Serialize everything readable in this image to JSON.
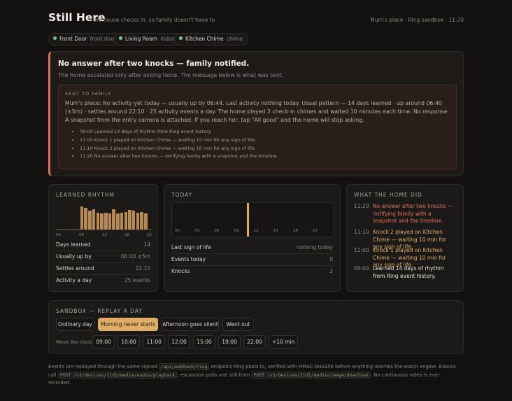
{
  "header": {
    "title": "Still Here",
    "tagline": "the house checks in, so family doesn't have to",
    "status": "Mum's place · Ring sandbox · 11:20"
  },
  "devices": [
    {
      "name": "Front Door",
      "type": "front door"
    },
    {
      "name": "Living Room",
      "type": "indoor"
    },
    {
      "name": "Kitchen Chime",
      "type": "chime"
    }
  ],
  "alert": {
    "title": "No answer after two knocks — family notified.",
    "subtitle": "The home escalated only after asking twice. The message below is what was sent.",
    "sent_label": "SENT TO FAMILY",
    "message": "Mum's place: No activity yet today — usually up by 06:44. Last activity nothing today. Usual pattern — 14 days learned · up around 06:40 (±5m) · settles around 22:10 · 25 activity events a day. The home played 2 check-in chimes and waited 10 minutes each time. No response. A snapshot from the entry camera is attached. If you reach her, tap \"All good\" and the home will stop asking.",
    "log": [
      "09:00 Learned 14 days of rhythm from Ring event history.",
      "11:00 Knock 1 played on Kitchen Chime — waiting 10 min for any sign of life.",
      "11:10 Knock 2 played on Kitchen Chime — waiting 10 min for any sign of life.",
      "11:20 No answer after two knocks — notifying family with a snapshot and the timeline."
    ]
  },
  "rhythm": {
    "title": "LEARNED RHYTHM",
    "axis": [
      "00",
      "06",
      "12",
      "18",
      "23"
    ],
    "hourly_activity": [
      0,
      0,
      0,
      0,
      0,
      0,
      0.82,
      0.78,
      0.68,
      0.72,
      0.6,
      0.58,
      0.6,
      0.58,
      0.72,
      0.58,
      0.6,
      0.62,
      0.7,
      0.68,
      0.6,
      0.62,
      0.58,
      0
    ],
    "rows": [
      {
        "k": "Days learned",
        "v": "14"
      },
      {
        "k": "Usually up by",
        "v": "06:40 ±5m"
      },
      {
        "k": "Settles around",
        "v": "22:10"
      },
      {
        "k": "Activity a day",
        "v": "25 events"
      }
    ]
  },
  "today": {
    "title": "TODAY",
    "axis": [
      "00",
      "03",
      "06",
      "09",
      "12",
      "15",
      "18",
      "21"
    ],
    "now_hour": 11.33,
    "rows": [
      {
        "k": "Last sign of life",
        "v": "nothing today"
      },
      {
        "k": "Events today",
        "v": "0"
      },
      {
        "k": "Knocks",
        "v": "2"
      }
    ]
  },
  "timeline": {
    "title": "WHAT THE HOME DID",
    "entries": [
      {
        "time": "11:20",
        "text": "No answer after two knocks — notifying family with a snapshot and the timeline.",
        "tone": "alert"
      },
      {
        "time": "11:10",
        "text": "Knock 2 played on Kitchen Chime — waiting 10 min for any sign of life.",
        "tone": "warn"
      },
      {
        "time": "11:00",
        "text": "Knock 1 played on Kitchen Chime — waiting 10 min for any sign of life.",
        "tone": "warn"
      },
      {
        "time": "09:00",
        "text": "Learned 14 days of rhythm from Ring event history.",
        "tone": "normal"
      }
    ]
  },
  "sandbox": {
    "title": "SANDBOX — REPLAY A DAY",
    "scenarios": [
      "Ordinary day",
      "Morning never starts",
      "Afternoon goes silent",
      "Went out"
    ],
    "active_scenario": "Morning never starts",
    "clock_label": "Move the clock:",
    "clock_buttons": [
      "09:00",
      "10:00",
      "11:00",
      "12:00",
      "15:00",
      "19:00",
      "22:00",
      "+10 min"
    ]
  },
  "footer": {
    "p1": "Events are replayed through the same signed",
    "c1": "/api/webhook/ring",
    "p2": "endpoint Ring posts to, verified with HMAC-SHA256 before anything reaches the watch engine. Knocks call",
    "c2": "POST /v1/devices/{id}/media/audio/playback",
    "p3": "; escalation pulls one still from",
    "c3": "POST /v1/devices/{id}/media/image/download",
    "p4": ". No continuous video is ever recorded."
  },
  "colors": {
    "accent": "#e0ad67",
    "alert": "#e0705a",
    "warn": "#e0ad67",
    "online": "#7cc48a"
  }
}
